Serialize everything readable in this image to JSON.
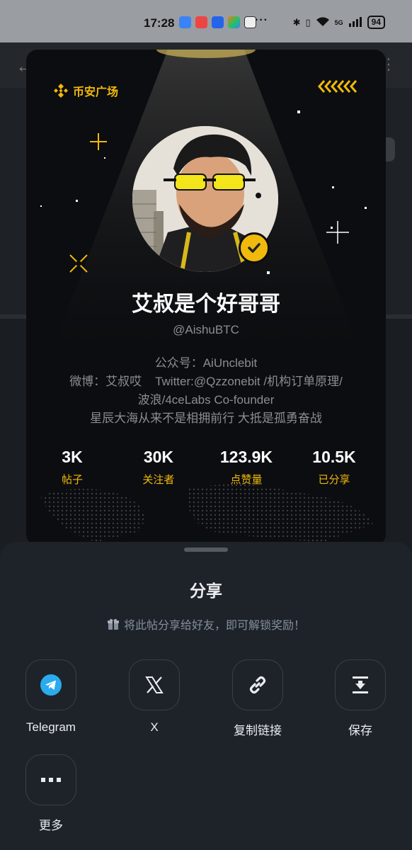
{
  "status_bar": {
    "time": "17:28",
    "dots": "···",
    "network": "5G",
    "battery": "94"
  },
  "card": {
    "brand": "币安广场",
    "name": "艾叔是个好哥哥",
    "handle": "@AishuBTC",
    "bio": [
      "公众号：AiUnclebit",
      "微博：艾叔哎    Twitter:@Qzzonebit /机构订单原理/",
      "波浪/4ceLabs Co-founder",
      "星辰大海从来不是相拥前行 大抵是孤勇奋战"
    ],
    "stats": [
      {
        "value": "3K",
        "label": "帖子"
      },
      {
        "value": "30K",
        "label": "关注者"
      },
      {
        "value": "123.9K",
        "label": "点赞量"
      },
      {
        "value": "10.5K",
        "label": "已分享"
      }
    ]
  },
  "share_sheet": {
    "title": "分享",
    "hint": "将此帖分享给好友，即可解锁奖励！",
    "options": [
      {
        "label": "Telegram",
        "icon": "telegram-icon"
      },
      {
        "label": "X",
        "icon": "x-logo-icon"
      },
      {
        "label": "复制链接",
        "icon": "link-icon"
      },
      {
        "label": "保存",
        "icon": "save-download-icon"
      },
      {
        "label": "更多",
        "icon": "more-icon"
      }
    ]
  },
  "colors": {
    "accent": "#f0b90b",
    "sheet_bg": "#1e2329",
    "card_bg": "#0c0d10"
  }
}
